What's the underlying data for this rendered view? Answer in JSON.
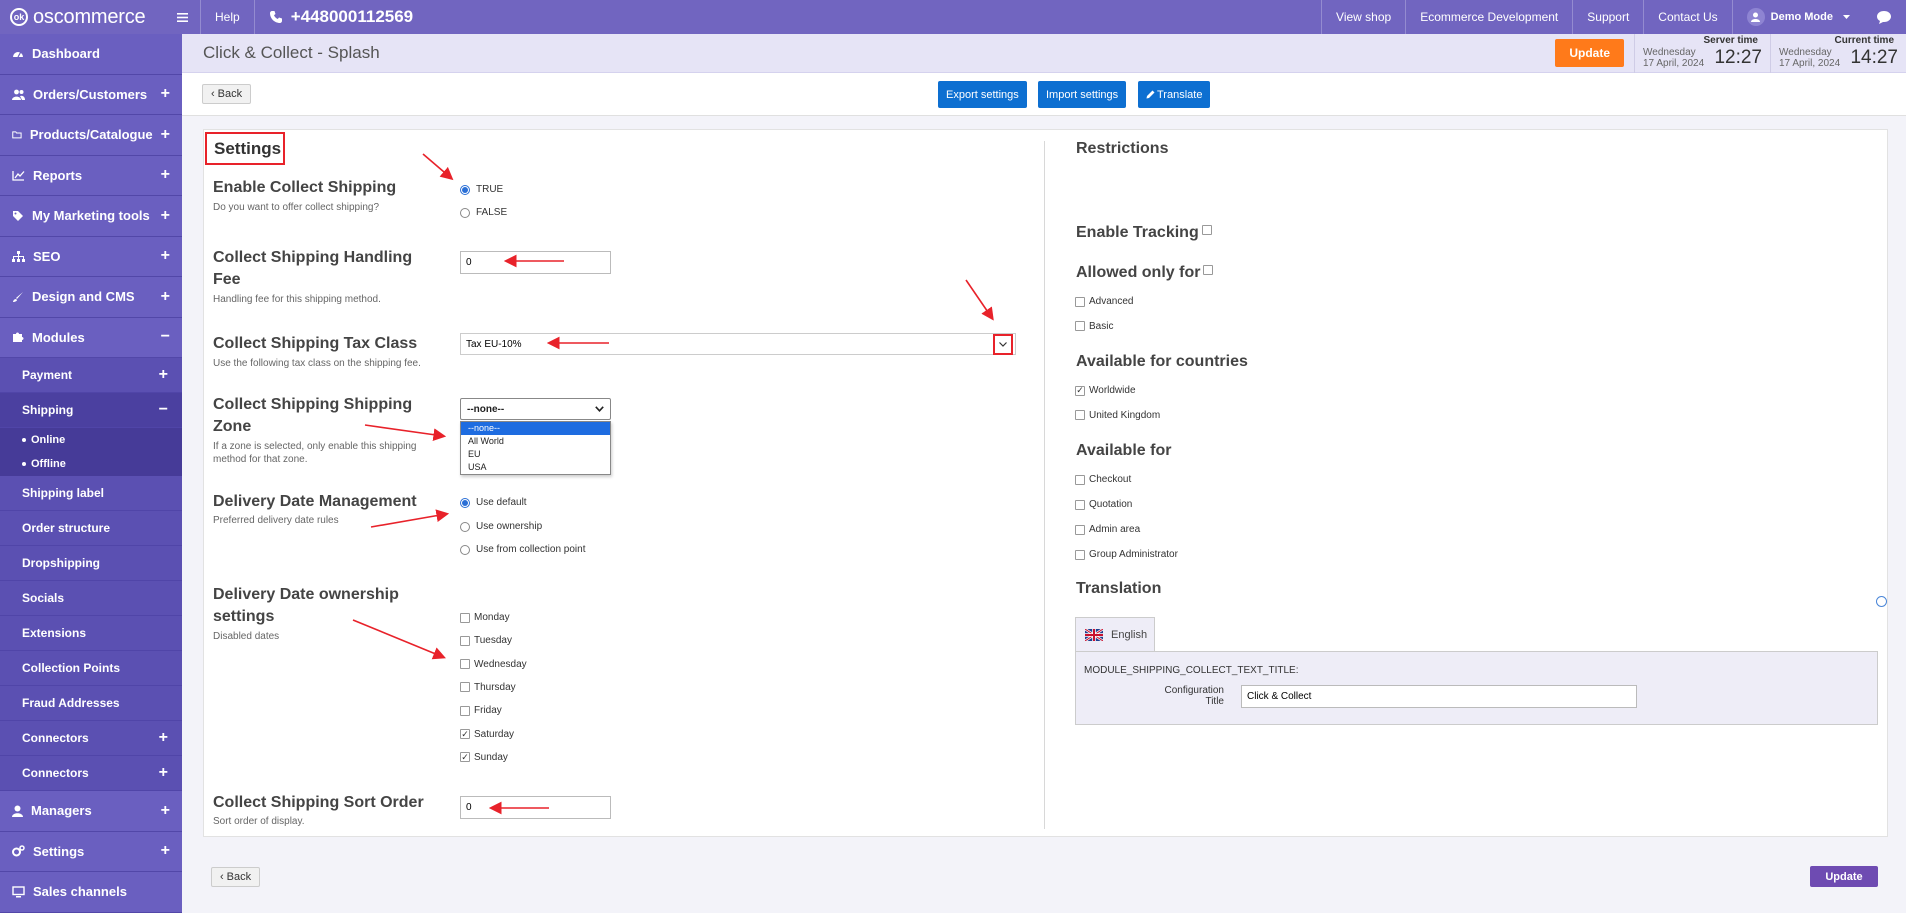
{
  "topbar": {
    "logo": "oscommerce",
    "logo_badge": "ok",
    "help": "Help",
    "phone": "+448000112569",
    "links": [
      "View shop",
      "Ecommerce Development",
      "Support",
      "Contact Us"
    ],
    "user": "Demo Mode"
  },
  "sidebar": {
    "main_top": [
      {
        "label": "Dashboard",
        "icon": "dashboard-icon",
        "toggle": ""
      },
      {
        "label": "Orders/Customers",
        "icon": "users-icon",
        "toggle": "+"
      },
      {
        "label": "Products/Catalogue",
        "icon": "folder-icon",
        "toggle": "+"
      },
      {
        "label": "Reports",
        "icon": "chart-icon",
        "toggle": "+"
      },
      {
        "label": "My Marketing tools",
        "icon": "tag-icon",
        "toggle": "+"
      },
      {
        "label": "SEO",
        "icon": "sitemap-icon",
        "toggle": "+"
      },
      {
        "label": "Design and CMS",
        "icon": "brush-icon",
        "toggle": "+"
      },
      {
        "label": "Modules",
        "icon": "puzzle-icon",
        "toggle": "−"
      }
    ],
    "modules_sub": [
      {
        "label": "Payment",
        "toggle": "+"
      },
      {
        "label": "Shipping",
        "toggle": "−"
      }
    ],
    "shipping_sub": [
      "Online",
      "Offline"
    ],
    "modules_sub2": [
      {
        "label": "Shipping label",
        "toggle": ""
      },
      {
        "label": "Order structure",
        "toggle": ""
      },
      {
        "label": "Dropshipping",
        "toggle": ""
      },
      {
        "label": "Socials",
        "toggle": ""
      },
      {
        "label": "Extensions",
        "toggle": ""
      },
      {
        "label": "Collection Points",
        "toggle": ""
      },
      {
        "label": "Fraud Addresses",
        "toggle": ""
      },
      {
        "label": "Connectors",
        "toggle": "+"
      },
      {
        "label": "Connectors",
        "toggle": "+"
      }
    ],
    "main_bottom": [
      {
        "label": "Managers",
        "icon": "user-icon",
        "toggle": "+"
      },
      {
        "label": "Settings",
        "icon": "gears-icon",
        "toggle": "+"
      },
      {
        "label": "Sales channels",
        "icon": "monitor-icon",
        "toggle": ""
      }
    ]
  },
  "header": {
    "title": "Click & Collect - Splash",
    "update": "Update",
    "server_label": "Server time",
    "server_date_1": "Wednesday",
    "server_date_2": "17 April, 2024",
    "server_time": "12:27",
    "current_label": "Current time",
    "current_date_1": "Wednesday",
    "current_date_2": "17 April, 2024",
    "current_time": "14:27"
  },
  "actions": {
    "back": "Back",
    "export": "Export settings",
    "import": "Import settings",
    "translate": "Translate"
  },
  "settings": {
    "heading": "Settings",
    "enable_title": "Enable Collect Shipping",
    "enable_desc": "Do you want to offer collect shipping?",
    "enable_options": [
      "TRUE",
      "FALSE"
    ],
    "handling_title_1": "Collect Shipping Handling",
    "handling_title_2": "Fee",
    "handling_desc": "Handling fee for this shipping method.",
    "handling_value": "0",
    "tax_title": "Collect Shipping Tax Class",
    "tax_desc": "Use the following tax class on the shipping fee.",
    "tax_value": "Tax EU-10%",
    "zone_title_1": "Collect Shipping Shipping",
    "zone_title_2": "Zone",
    "zone_desc_1": "If a zone is selected, only enable this shipping",
    "zone_desc_2": "method for that zone.",
    "zone_value": "--none--",
    "zone_options": [
      "--none--",
      "All World",
      "EU",
      "USA"
    ],
    "ddm_title": "Delivery Date Management",
    "ddm_desc": "Preferred delivery date rules",
    "ddm_options": [
      "Use default",
      "Use ownership",
      "Use from collection point"
    ],
    "ddo_title_1": "Delivery Date ownership",
    "ddo_title_2": "settings",
    "ddo_desc": "Disabled dates",
    "days": [
      {
        "label": "Monday",
        "checked": false
      },
      {
        "label": "Tuesday",
        "checked": false
      },
      {
        "label": "Wednesday",
        "checked": false
      },
      {
        "label": "Thursday",
        "checked": false
      },
      {
        "label": "Friday",
        "checked": false
      },
      {
        "label": "Saturday",
        "checked": true
      },
      {
        "label": "Sunday",
        "checked": true
      }
    ],
    "sort_title": "Collect Shipping Sort Order",
    "sort_desc": "Sort order of display.",
    "sort_value": "0"
  },
  "restrictions": {
    "heading": "Restrictions",
    "tracking": "Enable Tracking",
    "allowed": "Allowed only for",
    "allowed_options": [
      {
        "label": "Advanced",
        "checked": false
      },
      {
        "label": "Basic",
        "checked": false
      }
    ],
    "countries": "Available for countries",
    "country_options": [
      {
        "label": "Worldwide",
        "checked": true
      },
      {
        "label": "United Kingdom",
        "checked": false
      }
    ],
    "available": "Available for",
    "available_options": [
      {
        "label": "Checkout",
        "checked": false
      },
      {
        "label": "Quotation",
        "checked": false
      },
      {
        "label": "Admin area",
        "checked": false
      },
      {
        "label": "Group Administrator",
        "checked": false
      }
    ],
    "translation": "Translation",
    "tab_en": "English",
    "key": "MODULE_SHIPPING_COLLECT_TEXT_TITLE:",
    "config_label": "Configuration Title",
    "config_value": "Click & Collect"
  },
  "footer": {
    "back": "Back",
    "update": "Update"
  },
  "colors": {
    "topbar": "#7165c0",
    "sidebar": "#5a4fb0",
    "primary": "#0d6fd1",
    "orange": "#ff7a1a",
    "annotation": "#e8222a"
  }
}
